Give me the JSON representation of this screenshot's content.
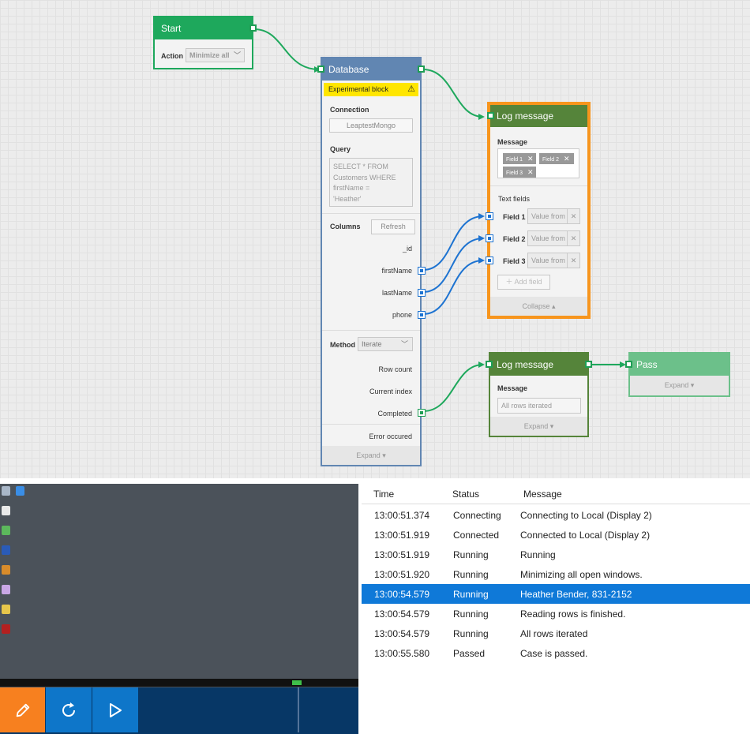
{
  "start": {
    "title": "Start",
    "action_label": "Action",
    "action_value": "Minimize all"
  },
  "database": {
    "title": "Database",
    "badge": "Experimental block",
    "connection_label": "Connection",
    "connection_value": "LeaptestMongo",
    "query_label": "Query",
    "query_lines": [
      "SELECT * FROM",
      "Customers WHERE",
      "firstName =",
      "'Heather'"
    ],
    "columns_label": "Columns",
    "refresh": "Refresh",
    "columns": [
      "_id",
      "firstName",
      "lastName",
      "phone"
    ],
    "method_label": "Method",
    "method_value": "Iterate",
    "outputs": [
      "Row count",
      "Current index",
      "Completed",
      "Error occured"
    ],
    "expand": "Expand"
  },
  "log1": {
    "title": "Log message",
    "message_label": "Message",
    "tags": [
      "Field 1",
      "Field 2",
      "Field 3"
    ],
    "text_fields_label": "Text fields",
    "fields": [
      {
        "label": "Field 1",
        "placeholder": "Value from"
      },
      {
        "label": "Field 2",
        "placeholder": "Value from"
      },
      {
        "label": "Field 3",
        "placeholder": "Value from"
      }
    ],
    "add_field": "Add field",
    "collapse": "Collapse"
  },
  "log2": {
    "title": "Log message",
    "message_label": "Message",
    "message_value": "All rows iterated",
    "expand": "Expand"
  },
  "pass": {
    "title": "Pass",
    "expand": "Expand"
  },
  "colors": {
    "green": "#1ea85c",
    "blue_head": "#6186b2",
    "olive": "#55843a",
    "orange": "#f7951d",
    "select": "#0f79d8",
    "action_bar": "#073766",
    "edit": "#f7801f",
    "action_btn": "#0e76c9"
  },
  "log": {
    "headers": {
      "time": "Time",
      "status": "Status",
      "message": "Message"
    },
    "rows": [
      {
        "time": "13:00:51.374",
        "status": "Connecting",
        "message": "Connecting to Local (Display 2)"
      },
      {
        "time": "13:00:51.919",
        "status": "Connected",
        "message": "Connected to Local (Display 2)"
      },
      {
        "time": "13:00:51.919",
        "status": "Running",
        "message": "Running"
      },
      {
        "time": "13:00:51.920",
        "status": "Running",
        "message": "Minimizing all open windows."
      },
      {
        "time": "13:00:54.579",
        "status": "Running",
        "message": "Heather Bender, 831-2152"
      },
      {
        "time": "13:00:54.579",
        "status": "Running",
        "message": "Reading rows is finished."
      },
      {
        "time": "13:00:54.579",
        "status": "Running",
        "message": "All rows iterated"
      },
      {
        "time": "13:00:55.580",
        "status": "Passed",
        "message": "Case is passed."
      }
    ]
  },
  "icons": {
    "edit": "pencil-icon",
    "reload": "refresh-icon",
    "run": "play-icon",
    "warning": "warning-icon",
    "close": "close-icon"
  }
}
